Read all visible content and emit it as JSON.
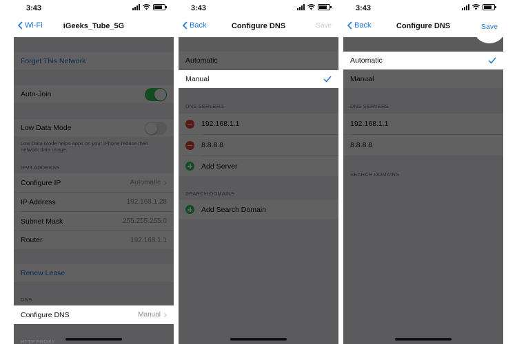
{
  "status": {
    "time": "3:43"
  },
  "screen1": {
    "back_label": "Wi-Fi",
    "title": "iGeeks_Tube_5G",
    "forget": "Forget This Network",
    "auto_join": "Auto-Join",
    "low_data": "Low Data Mode",
    "low_data_footer": "Low Data Mode helps apps on your iPhone reduce their network data usage.",
    "ipv4_header": "IPV4 ADDRESS",
    "configure_ip": {
      "label": "Configure IP",
      "value": "Automatic"
    },
    "ip_address": {
      "label": "IP Address",
      "value": "192.168.1.28"
    },
    "subnet": {
      "label": "Subnet Mask",
      "value": "255.255.255.0"
    },
    "router": {
      "label": "Router",
      "value": "192.168.1.1"
    },
    "renew": "Renew Lease",
    "dns_header": "DNS",
    "configure_dns": {
      "label": "Configure DNS",
      "value": "Manual"
    },
    "http_proxy_header": "HTTP PROXY",
    "auto_join_on": true,
    "low_data_on": false
  },
  "screen2": {
    "back_label": "Back",
    "title": "Configure DNS",
    "save": "Save",
    "automatic": "Automatic",
    "manual": "Manual",
    "dns_servers_header": "DNS SERVERS",
    "servers": [
      "192.168.1.1",
      "8.8.8.8"
    ],
    "add_server": "Add Server",
    "search_domains_header": "SEARCH DOMAINS",
    "add_search_domain": "Add Search Domain"
  },
  "screen3": {
    "back_label": "Back",
    "title": "Configure DNS",
    "save": "Save",
    "automatic": "Automatic",
    "manual": "Manual",
    "dns_servers_header": "DNS SERVERS",
    "servers": [
      "192.168.1.1",
      "8.8.8.8"
    ],
    "search_domains_header": "SEARCH DOMAINS"
  },
  "colors": {
    "accent": "#1b76d6",
    "toggle_on": "#34c759",
    "delete": "#e6423a",
    "group_bg": "#efeff4"
  }
}
